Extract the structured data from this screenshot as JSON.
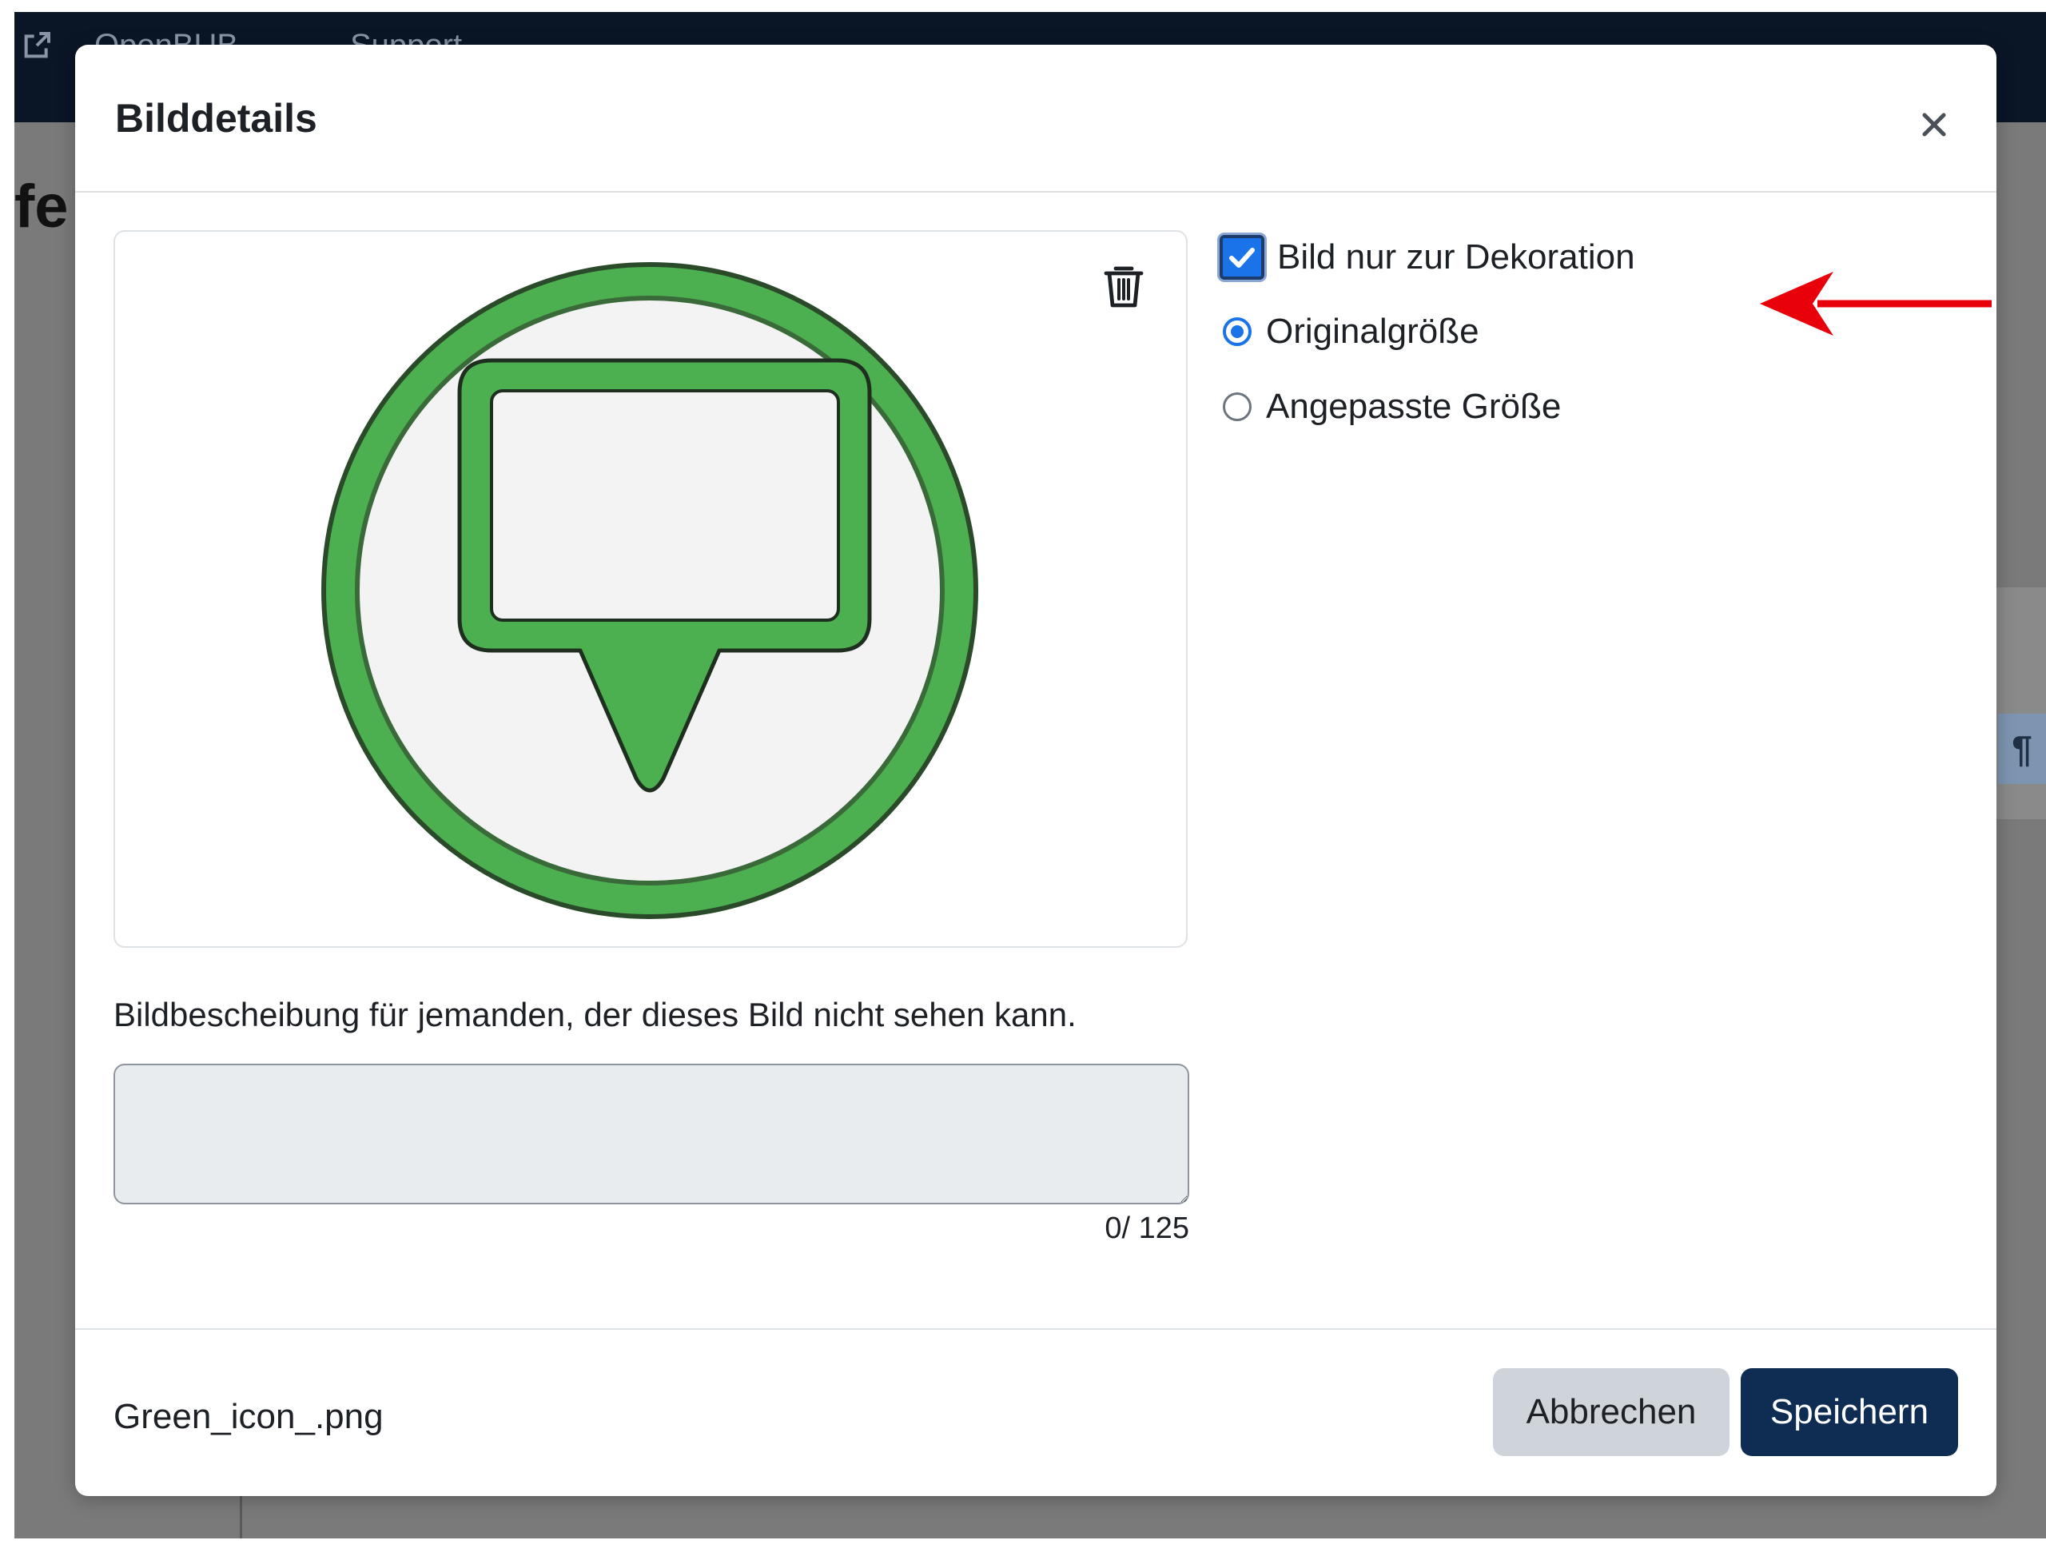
{
  "background": {
    "nav_links": [
      "OpenBUB",
      "Support"
    ],
    "heading_fragment": "fe",
    "pilcrow": "¶"
  },
  "modal": {
    "title": "Bilddetails",
    "close_symbol": "×",
    "preview": {
      "image_alt": "Green speech bubble icon",
      "colors": {
        "ring": "#4caf50",
        "fill": "#f3f3f3",
        "outline": "#1f2f1f"
      }
    },
    "options": {
      "decorative_label": "Bild nur zur Dekoration",
      "decorative_checked": true,
      "size_original_label": "Originalgröße",
      "size_custom_label": "Angepasste Größe",
      "size_selected": "original"
    },
    "description": {
      "label": "Bildbescheibung für jemanden, der dieses Bild nicht sehen kann.",
      "value": "",
      "counter": "0/ 125"
    },
    "footer": {
      "file_name": "Green_icon_.png",
      "cancel_label": "Abbrechen",
      "save_label": "Speichern"
    }
  },
  "colors": {
    "primary": "#0f2d52",
    "checkbox": "#1a73e8",
    "annotation_arrow": "#e8000b"
  }
}
